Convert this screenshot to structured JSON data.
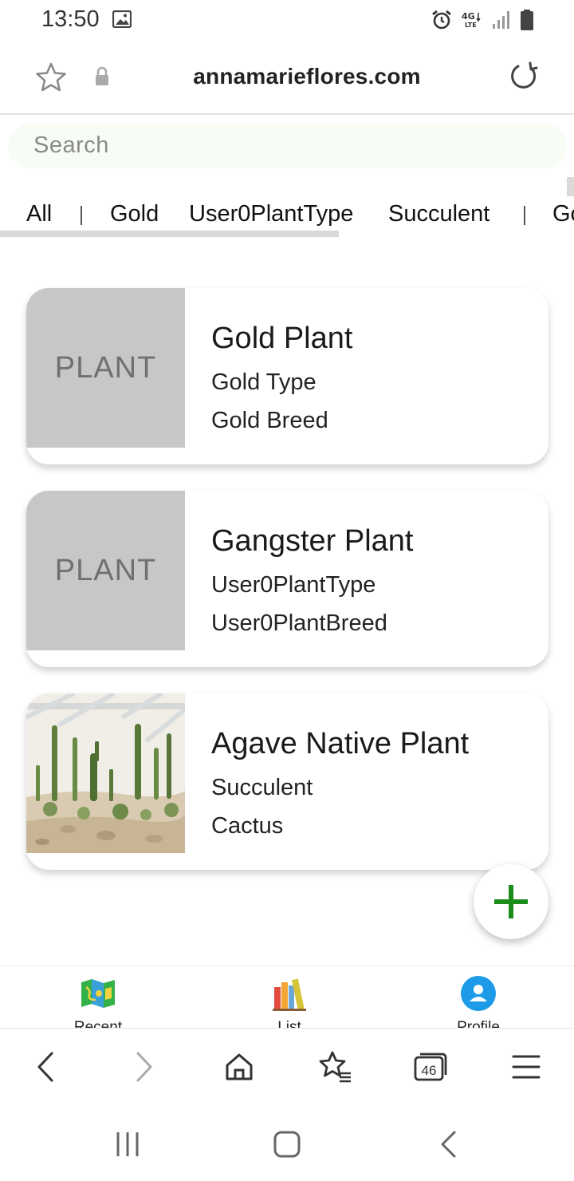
{
  "status_bar": {
    "time": "13:50",
    "network": "4G LTE"
  },
  "url_bar": {
    "domain": "annamarieflores.com"
  },
  "search": {
    "placeholder": "Search"
  },
  "tabs": [
    "All",
    "Gold",
    "User0PlantType",
    "Succulent",
    "Go"
  ],
  "cards": [
    {
      "name": "Gold Plant",
      "type": "Gold Type",
      "breed": "Gold Breed",
      "thumb": "PLANT"
    },
    {
      "name": "Gangster Plant",
      "type": "User0PlantType",
      "breed": "User0PlantBreed",
      "thumb": "PLANT"
    },
    {
      "name": "Agave Native Plant",
      "type": "Succulent",
      "breed": "Cactus",
      "thumb": "cactus-garden-photo"
    }
  ],
  "fab": {
    "icon": "plus-icon",
    "color": "#1a8c1a"
  },
  "app_nav": [
    {
      "label": "Recent",
      "icon": "map-icon"
    },
    {
      "label": "List",
      "icon": "books-icon"
    },
    {
      "label": "Profile",
      "icon": "profile-icon"
    }
  ],
  "browser_bar": {
    "tab_count": "46"
  },
  "colors": {
    "accent_green": "#1a8c1a",
    "profile_blue": "#1e9be8",
    "thumb_gray": "#c7c7c7"
  }
}
